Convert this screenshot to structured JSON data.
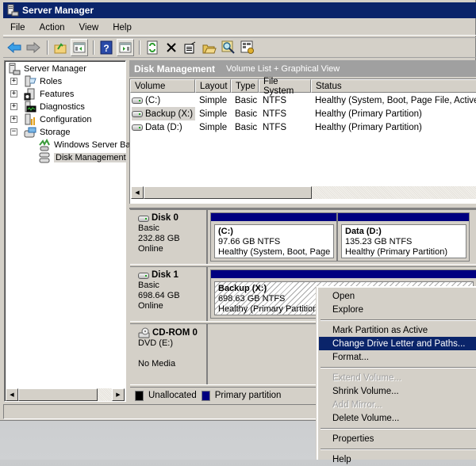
{
  "window": {
    "title": "Server Manager"
  },
  "menubar": {
    "items": [
      "File",
      "Action",
      "View",
      "Help"
    ]
  },
  "toolbar": {
    "buttons": [
      {
        "name": "back-button",
        "icon": "back-arrow-icon"
      },
      {
        "name": "forward-button",
        "icon": "forward-arrow-icon"
      },
      {
        "name": "up-one-level-button",
        "icon": "up-folder-icon"
      },
      {
        "name": "show-hide-console-tree-button",
        "icon": "console-tree-icon"
      },
      {
        "name": "help-button",
        "icon": "help-icon"
      },
      {
        "name": "show-hide-action-pane-button",
        "icon": "action-pane-icon"
      },
      {
        "name": "refresh-button",
        "icon": "refresh-icon"
      },
      {
        "name": "delete-button",
        "icon": "delete-x-icon"
      },
      {
        "name": "properties-button",
        "icon": "properties-icon"
      },
      {
        "name": "open-button",
        "icon": "open-folder-icon"
      },
      {
        "name": "explore-button",
        "icon": "magnifier-icon"
      },
      {
        "name": "settings-button",
        "icon": "settings-grid-icon"
      }
    ]
  },
  "tree": {
    "root": "Server Manager",
    "items": [
      {
        "label": "Roles",
        "expander": "+"
      },
      {
        "label": "Features",
        "expander": "+"
      },
      {
        "label": "Diagnostics",
        "expander": "+"
      },
      {
        "label": "Configuration",
        "expander": "+"
      },
      {
        "label": "Storage",
        "expander": "−"
      }
    ],
    "children": [
      {
        "label": "Windows Server Backup"
      },
      {
        "label": "Disk Management",
        "selected": true
      }
    ]
  },
  "pane_header": {
    "title": "Disk Management",
    "subtitle": "Volume List + Graphical View"
  },
  "volume_list": {
    "columns": [
      "Volume",
      "Layout",
      "Type",
      "File System",
      "Status"
    ],
    "rows": [
      {
        "volume": " (C:)",
        "layout": "Simple",
        "type": "Basic",
        "fs": "NTFS",
        "status": "Healthy (System, Boot, Page File, Active, Crash Dump, Primary Partition)"
      },
      {
        "volume": "Backup (X:)",
        "layout": "Simple",
        "type": "Basic",
        "fs": "NTFS",
        "status": "Healthy (Primary Partition)",
        "selected": true
      },
      {
        "volume": "Data (D:)",
        "layout": "Simple",
        "type": "Basic",
        "fs": "NTFS",
        "status": "Healthy (Primary Partition)"
      }
    ]
  },
  "disks": [
    {
      "name": "Disk 0",
      "type": "Basic",
      "size": "232.88 GB",
      "state": "Online",
      "partitions": [
        {
          "name": " (C:)",
          "size": "97.66 GB NTFS",
          "status": "Healthy (System, Boot, Page File, Active, Crash Dump, Primary Partition)"
        },
        {
          "name": "Data  (D:)",
          "size": "135.23 GB NTFS",
          "status": "Healthy (Primary Partition)"
        }
      ]
    },
    {
      "name": "Disk 1",
      "type": "Basic",
      "size": "698.64 GB",
      "state": "Online",
      "partitions": [
        {
          "name": "Backup  (X:)",
          "size": "698.63 GB NTFS",
          "status": "Healthy (Primary Partition)",
          "selected": true
        }
      ]
    },
    {
      "name": "CD-ROM 0",
      "type": "DVD (E:)",
      "size": "",
      "state": "No Media",
      "partitions": []
    }
  ],
  "legend": {
    "items": [
      {
        "label": "Unallocated",
        "color": "#000000"
      },
      {
        "label": "Primary partition",
        "color": "#000080"
      }
    ]
  },
  "context_menu": {
    "items": [
      {
        "label": "Open",
        "enabled": true
      },
      {
        "label": "Explore",
        "enabled": true
      },
      {
        "separator": true
      },
      {
        "label": "Mark Partition as Active",
        "enabled": true
      },
      {
        "label": "Change Drive Letter and Paths...",
        "enabled": true,
        "highlighted": true
      },
      {
        "label": "Format...",
        "enabled": true
      },
      {
        "separator": true
      },
      {
        "label": "Extend Volume...",
        "enabled": false
      },
      {
        "label": "Shrink Volume...",
        "enabled": true
      },
      {
        "label": "Add Mirror...",
        "enabled": false
      },
      {
        "label": "Delete Volume...",
        "enabled": true
      },
      {
        "separator": true
      },
      {
        "label": "Properties",
        "enabled": true
      },
      {
        "separator": true
      },
      {
        "label": "Help",
        "enabled": true
      }
    ]
  },
  "colors": {
    "titlebar": "#0a246a",
    "primary_partition": "#000080",
    "highlight": "#0a246a",
    "chrome": "#d4d0c8"
  }
}
